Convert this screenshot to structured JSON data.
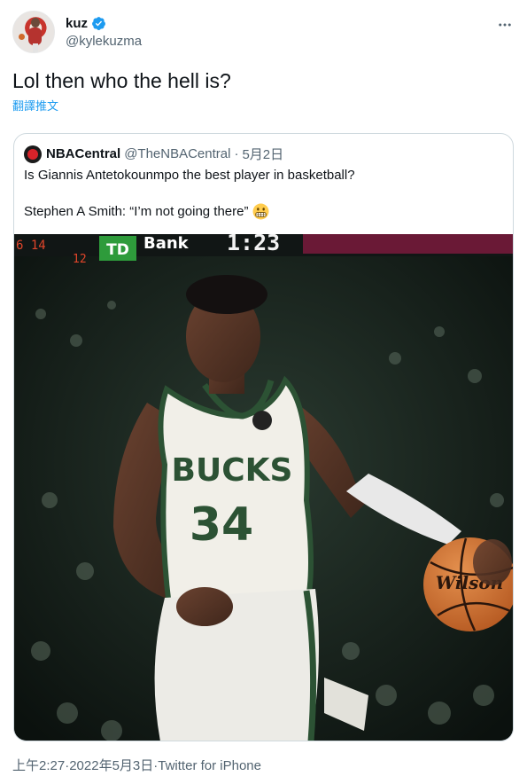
{
  "header": {
    "display_name": "kuz",
    "handle": "@kylekuzma",
    "avatar_icon": "user-avatar-icon",
    "verified_icon": "verified-badge-icon",
    "more_icon": "more-options-icon"
  },
  "tweet": {
    "text": "Lol then who the hell is?",
    "translate_label": "翻譯推文"
  },
  "quote": {
    "name": "NBACentral",
    "handle": "@TheNBACentral",
    "separator": "·",
    "date": "5月2日",
    "line1": "Is Giannis Antetokounmpo the best player in basketball?",
    "line2": "Stephen A Smith: “I’m not going there”",
    "emoji_icon": "grimacing-face-emoji",
    "photo": {
      "jersey_text": "BUCKS",
      "jersey_number": "34",
      "ball_brand": "Wilson",
      "scoreboard_sponsor": "Bank",
      "scoreboard_logo": "TD",
      "scoreboard_time": "1:23"
    }
  },
  "footer": {
    "time": "上午2:27",
    "sep1": " · ",
    "date": "2022年5月3日",
    "sep2": " · ",
    "source": "Twitter for iPhone"
  },
  "colors": {
    "text_primary": "#0f1419",
    "text_secondary": "#536471",
    "link": "#1d9bf0",
    "border": "#cfd9de",
    "bucks_green": "#2c5234"
  }
}
